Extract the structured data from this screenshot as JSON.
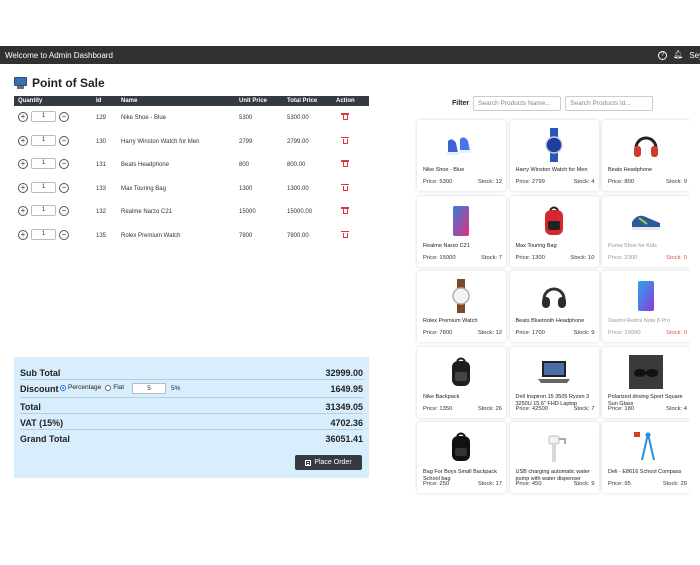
{
  "header": {
    "title": "Welcome to Admin Dashboard",
    "help_glyph": "?",
    "user": "Seyan"
  },
  "pos": {
    "title": "Point of Sale"
  },
  "cart": {
    "columns": [
      "Quantity",
      "Id",
      "Name",
      "Unit Price",
      "Total Price",
      "Action"
    ],
    "rows": [
      {
        "qty": "1",
        "id": "129",
        "name": "Nike Shoe - Blue",
        "unit": "5300",
        "total": "5300.00"
      },
      {
        "qty": "1",
        "id": "130",
        "name": "Harry Winston Watch for Men",
        "unit": "2799",
        "total": "2799.00"
      },
      {
        "qty": "1",
        "id": "131",
        "name": "Beats Headphone",
        "unit": "800",
        "total": "800.00"
      },
      {
        "qty": "1",
        "id": "133",
        "name": "Max Touring Bag",
        "unit": "1300",
        "total": "1300.00"
      },
      {
        "qty": "1",
        "id": "132",
        "name": "Realme Narzo C21",
        "unit": "15000",
        "total": "15000.00"
      },
      {
        "qty": "1",
        "id": "135",
        "name": "Rolex Premium Watch",
        "unit": "7800",
        "total": "7800.00"
      }
    ]
  },
  "totals": {
    "subtotal_label": "Sub Total",
    "subtotal": "32999.00",
    "discount_label": "Discount",
    "percentage_label": "Percentage",
    "flat_label": "Flat",
    "discount_input": "5",
    "discount_pct": "5%",
    "discount": "1649.95",
    "total_label": "Total",
    "total": "31349.05",
    "vat_label": "VAT (15%)",
    "vat": "4702.36",
    "grand_label": "Grand Total",
    "grand": "36051.41",
    "place_order": "Place Order"
  },
  "filter": {
    "label": "Filter",
    "name_placeholder": "Search Products Name...",
    "id_placeholder": "Search Products Id..."
  },
  "products": [
    {
      "name": "Nike Shoe - Blue",
      "price": "Price: 5300",
      "stock": "Stock: 12",
      "icon": "shoe-blue",
      "oos": false
    },
    {
      "name": "Harry Winston Watch for Men",
      "price": "Price: 2799",
      "stock": "Stock: 4",
      "icon": "watch-blue",
      "oos": false
    },
    {
      "name": "Beats Headphone",
      "price": "Price: 800",
      "stock": "Stock: 9",
      "icon": "headphone-red",
      "oos": false
    },
    {
      "name": "Realme Narzo C21",
      "price": "Price: 15000",
      "stock": "Stock: 7",
      "icon": "phone-pink",
      "oos": false
    },
    {
      "name": "Max Touring Bag",
      "price": "Price: 1300",
      "stock": "Stock: 10",
      "icon": "backpack-red",
      "oos": false
    },
    {
      "name": "Puma Shoe for Kids",
      "price": "Price: 2300",
      "stock": "Stock: 0",
      "icon": "shoe-kids",
      "oos": true
    },
    {
      "name": "Rolex Premium Watch",
      "price": "Price: 7800",
      "stock": "Stock: 12",
      "icon": "watch-brown",
      "oos": false
    },
    {
      "name": "Beats Bluetooth Headphone",
      "price": "Price: 1700",
      "stock": "Stock: 9",
      "icon": "headphone-black",
      "oos": false
    },
    {
      "name": "Xiaomi Redmi Note 8 Pro",
      "price": "Price: 19990",
      "stock": "Stock: 0",
      "icon": "phone-blue",
      "oos": true
    },
    {
      "name": "Nike Backpack",
      "price": "Price: 1350",
      "stock": "Stock: 26",
      "icon": "backpack-black",
      "oos": false
    },
    {
      "name": "Dell Inspiron 15 3505 Ryzen 3 3250U 15.6\" FHD Laptop",
      "price": "Price: 42500",
      "stock": "Stock: 7",
      "icon": "laptop",
      "oos": false
    },
    {
      "name": "Polarized driving Sport Square Sun Glass",
      "price": "Price: 180",
      "stock": "Stock: 4",
      "icon": "sunglass",
      "oos": false
    },
    {
      "name": "Bag For Boys Small Backpack School bag",
      "price": "Price: 250",
      "stock": "Stock: 17",
      "icon": "backpack-small",
      "oos": false
    },
    {
      "name": "USB charging automatic water pump with water dispenser",
      "price": "Price: 450",
      "stock": "Stock: 9",
      "icon": "water-pump",
      "oos": false
    },
    {
      "name": "Deli - E8616 School Compass",
      "price": "Price: 95",
      "stock": "Stock: 29",
      "icon": "compass",
      "oos": false
    }
  ]
}
